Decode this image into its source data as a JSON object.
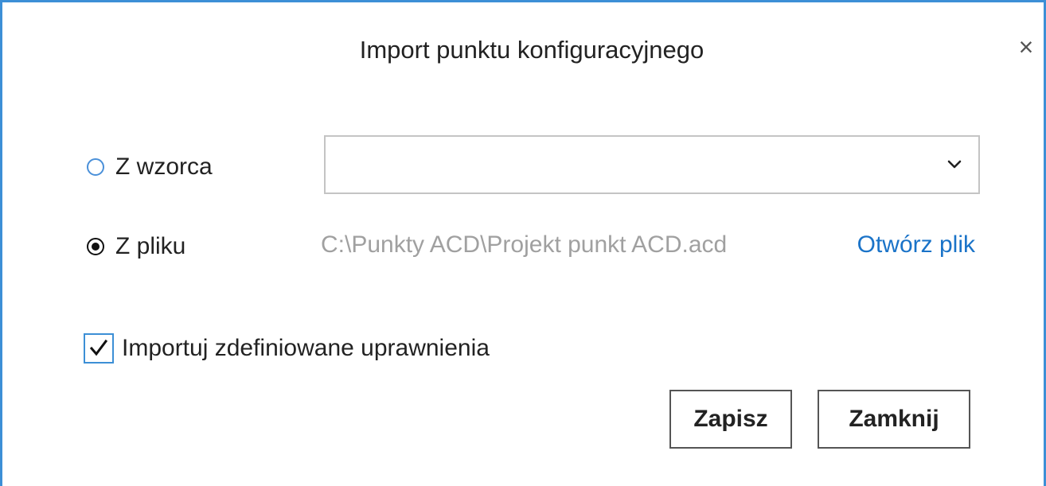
{
  "dialog": {
    "title": "Import punktu konfiguracyjnego",
    "close_glyph": "×",
    "accent_color": "#3c8fd6"
  },
  "source": {
    "template_option": {
      "label": "Z wzorca",
      "selected": false,
      "dropdown_value": ""
    },
    "file_option": {
      "label": "Z pliku",
      "selected": true,
      "path": "C:\\Punkty ACD\\Projekt punkt ACD.acd",
      "open_link": "Otwórz plik"
    }
  },
  "permissions": {
    "label": "Importuj zdefiniowane uprawnienia",
    "checked": true
  },
  "buttons": {
    "save_label": "Zapisz",
    "close_label": "Zamknij"
  }
}
